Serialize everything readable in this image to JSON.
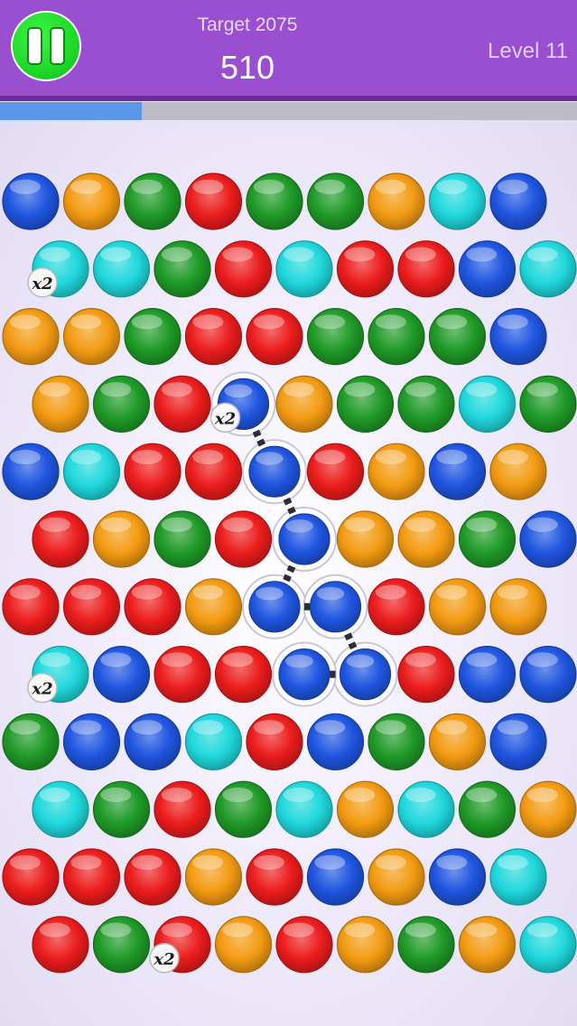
{
  "header": {
    "target_label": "Target 2075",
    "score": "510",
    "level_label": "Level 11",
    "pause_button": "pause-icon"
  },
  "progress": {
    "fraction": 0.245,
    "fill_color": "#5b97e8",
    "track_color": "#bdbcc6"
  },
  "colors": {
    "blue": "#1f55e0",
    "orange": "#f39b12",
    "green": "#1f9a27",
    "red": "#ec1c1c",
    "cyan": "#1fd8dc"
  },
  "board": {
    "rows": [
      [
        "blue",
        "orange",
        "green",
        "red",
        "green",
        "green",
        "orange",
        "cyan",
        "blue"
      ],
      [
        "cyan",
        "cyan",
        "green",
        "red",
        "cyan",
        "red",
        "red",
        "blue",
        "cyan"
      ],
      [
        "orange",
        "orange",
        "green",
        "red",
        "red",
        "green",
        "green",
        "green",
        "blue"
      ],
      [
        "orange",
        "green",
        "red",
        "blue",
        "orange",
        "green",
        "green",
        "cyan",
        "green"
      ],
      [
        "blue",
        "cyan",
        "red",
        "red",
        "blue",
        "red",
        "orange",
        "blue",
        "orange"
      ],
      [
        "red",
        "orange",
        "green",
        "red",
        "blue",
        "orange",
        "orange",
        "green",
        "blue"
      ],
      [
        "red",
        "red",
        "red",
        "orange",
        "blue",
        "blue",
        "red",
        "orange",
        "orange"
      ],
      [
        "cyan",
        "blue",
        "red",
        "red",
        "blue",
        "blue",
        "red",
        "blue",
        "blue"
      ],
      [
        "green",
        "blue",
        "blue",
        "cyan",
        "red",
        "blue",
        "green",
        "orange",
        "blue"
      ],
      [
        "cyan",
        "green",
        "red",
        "green",
        "cyan",
        "orange",
        "cyan",
        "green",
        "orange"
      ],
      [
        "red",
        "red",
        "red",
        "orange",
        "red",
        "blue",
        "orange",
        "blue",
        "cyan"
      ],
      [
        "red",
        "green",
        "red",
        "orange",
        "red",
        "orange",
        "green",
        "orange",
        "cyan"
      ]
    ],
    "multipliers": [
      {
        "row": 1,
        "col": 0,
        "label": "x2"
      },
      {
        "row": 3,
        "col": 3,
        "label": "x2"
      },
      {
        "row": 7,
        "col": 0,
        "label": "x2"
      },
      {
        "row": 11,
        "col": 2,
        "label": "x2"
      }
    ],
    "chain": [
      {
        "row": 3,
        "col": 3
      },
      {
        "row": 4,
        "col": 4
      },
      {
        "row": 5,
        "col": 4
      },
      {
        "row": 6,
        "col": 4
      },
      {
        "row": 6,
        "col": 5
      },
      {
        "row": 7,
        "col": 5
      },
      {
        "row": 7,
        "col": 4
      }
    ]
  }
}
